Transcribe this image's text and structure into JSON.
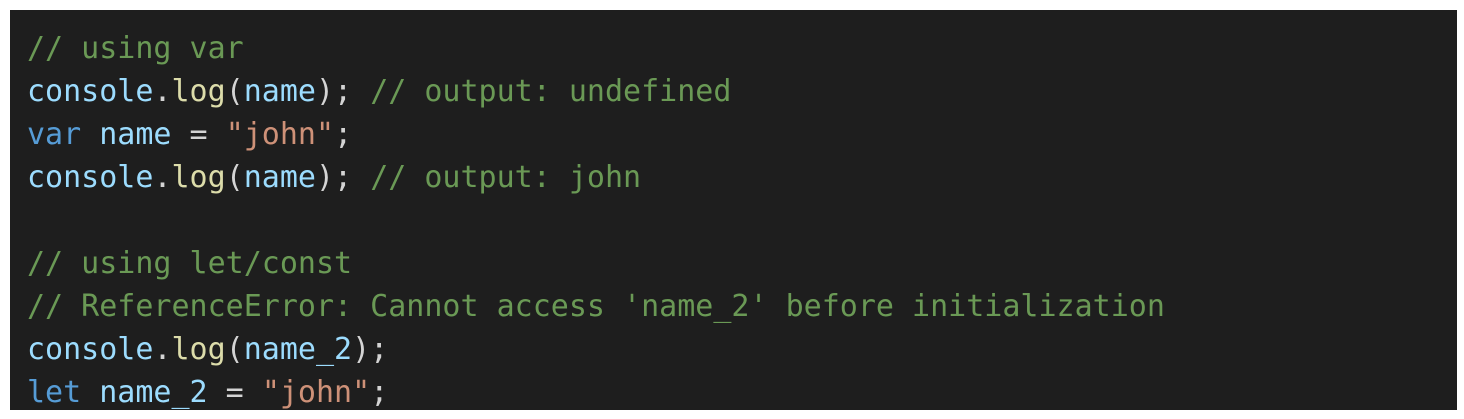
{
  "colors": {
    "background": "#1e1e1e",
    "comment": "#6a9955",
    "variable": "#9cdcfe",
    "function": "#dcdcaa",
    "keyword": "#569cd6",
    "string": "#ce9178",
    "punctuation": "#d4d4d4"
  },
  "code": {
    "line1": {
      "comment": "// using var"
    },
    "line2": {
      "obj": "console",
      "dot": ".",
      "fn": "log",
      "open": "(",
      "arg": "name",
      "close": ");",
      "space": " ",
      "comment": "// output: undefined"
    },
    "line3": {
      "kw": "var",
      "space1": " ",
      "ident": "name",
      "eq": " = ",
      "str": "\"john\"",
      "semi": ";"
    },
    "line4": {
      "obj": "console",
      "dot": ".",
      "fn": "log",
      "open": "(",
      "arg": "name",
      "close": ");",
      "space": " ",
      "comment": "// output: john"
    },
    "line6": {
      "comment": "// using let/const"
    },
    "line7": {
      "comment": "// ReferenceError: Cannot access 'name_2' before initialization"
    },
    "line8": {
      "obj": "console",
      "dot": ".",
      "fn": "log",
      "open": "(",
      "arg": "name_2",
      "close": ");"
    },
    "line9": {
      "kw": "let",
      "space1": " ",
      "ident": "name_2",
      "eq": " = ",
      "str": "\"john\"",
      "semi": ";"
    }
  }
}
